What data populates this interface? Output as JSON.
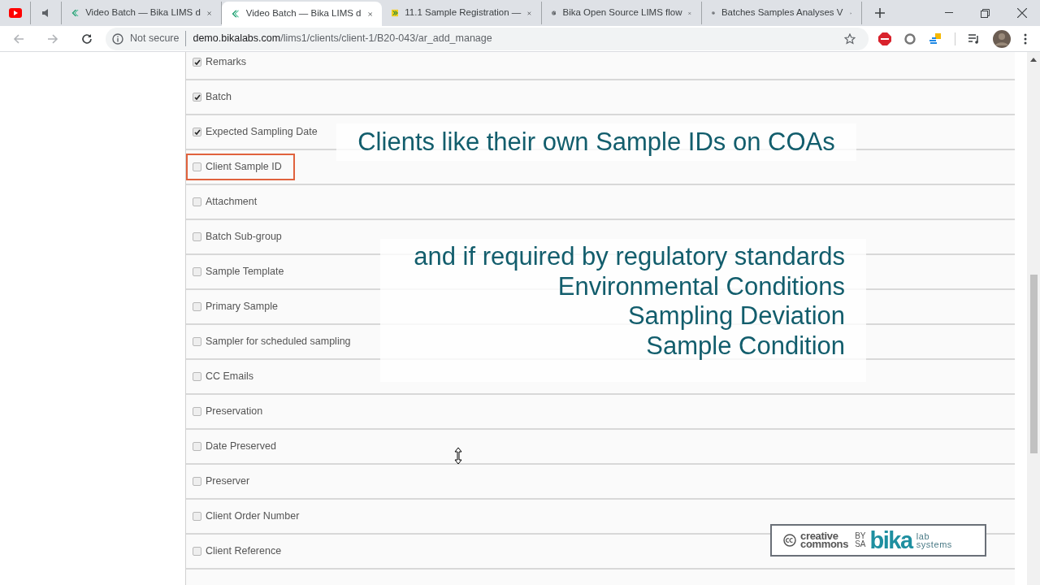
{
  "tabs": [
    {
      "kind": "video-pin",
      "selected": false
    },
    {
      "kind": "audio-pin",
      "selected": false
    },
    {
      "kind": "chevron",
      "title": "Video Batch — Bika LIMS d",
      "selected": false
    },
    {
      "kind": "chevron",
      "title": "Video Batch — Bika LIMS d",
      "selected": true
    },
    {
      "kind": "arrows",
      "title": "11.1 Sample Registration —",
      "selected": false
    },
    {
      "kind": "globe",
      "title": "Bika Open Source LIMS flow",
      "selected": false
    },
    {
      "kind": "globe",
      "title": "Batches Samples Analyses V",
      "selected": false
    }
  ],
  "address_bar": {
    "security": "Not secure",
    "url_host": "demo.bikalabs.com",
    "url_path": "/lims1/clients/client-1/B20-043/ar_add_manage"
  },
  "fields": [
    {
      "label": "Remarks",
      "checked": true,
      "highlighted": false
    },
    {
      "label": "Batch",
      "checked": true,
      "highlighted": false
    },
    {
      "label": "Expected Sampling Date",
      "checked": true,
      "highlighted": false
    },
    {
      "label": "Client Sample ID",
      "checked": false,
      "highlighted": true
    },
    {
      "label": "Attachment",
      "checked": false,
      "highlighted": false
    },
    {
      "label": "Batch Sub-group",
      "checked": false,
      "highlighted": false
    },
    {
      "label": "Sample Template",
      "checked": false,
      "highlighted": false
    },
    {
      "label": "Primary Sample",
      "checked": false,
      "highlighted": false
    },
    {
      "label": "Sampler for scheduled sampling",
      "checked": false,
      "highlighted": false
    },
    {
      "label": "CC Emails",
      "checked": false,
      "highlighted": false
    },
    {
      "label": "Preservation",
      "checked": false,
      "highlighted": false
    },
    {
      "label": "Date Preserved",
      "checked": false,
      "highlighted": false
    },
    {
      "label": "Preserver",
      "checked": false,
      "highlighted": false
    },
    {
      "label": "Client Order Number",
      "checked": false,
      "highlighted": false
    },
    {
      "label": "Client Reference",
      "checked": false,
      "highlighted": false
    }
  ],
  "captions": {
    "first": "Clients like their own Sample IDs on COAs",
    "second": [
      "and if required by regulatory standards",
      "Environmental Conditions",
      "Sampling Deviation",
      "Sample Condition"
    ]
  },
  "license_badge": {
    "cc_top": "creative",
    "cc_bottom": "commons",
    "by": "BY",
    "sa": "SA",
    "brand": "bika",
    "brand_top": "lab",
    "brand_bottom": "systems"
  }
}
